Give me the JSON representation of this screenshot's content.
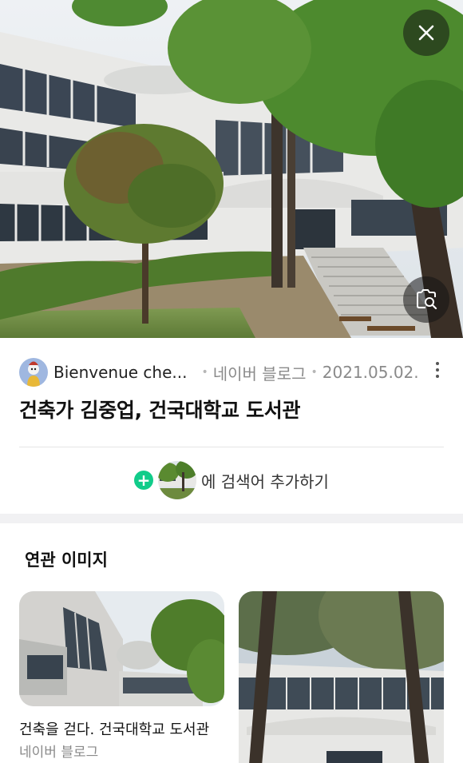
{
  "image_viewer": {
    "close_icon": "close-icon",
    "lens_icon": "image-search-icon"
  },
  "post": {
    "blog_name": "Bienvenue che...",
    "source": "네이버 블로그",
    "date": "2021.05.02.",
    "more_icon": "more-vertical-icon",
    "title": "건축가 김중업, 건국대학교 도서관"
  },
  "search_add": {
    "plus_icon": "plus-icon",
    "label": "에 검색어 추가하기",
    "accent": "#11cc8a"
  },
  "related": {
    "heading": "연관 이미지",
    "items": [
      {
        "caption": "건축을 걷다. 건국대학교 도서관",
        "source": "네이버 블로그"
      },
      {
        "caption": "",
        "source": ""
      }
    ]
  }
}
